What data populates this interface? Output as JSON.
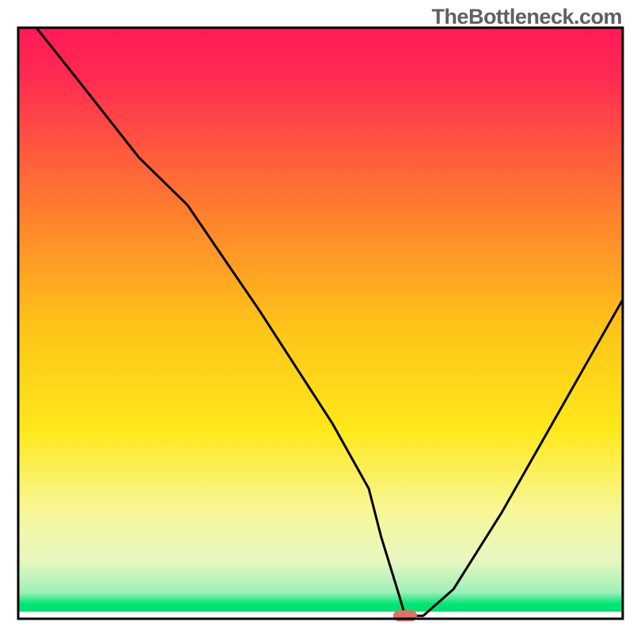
{
  "watermark": "TheBottleneck.com",
  "chart_data": {
    "type": "line",
    "title": "",
    "xlabel": "",
    "ylabel": "",
    "xlim": [
      0,
      100
    ],
    "ylim": [
      0,
      100
    ],
    "axes_visible": false,
    "background_gradient": {
      "top": "#ff1a56",
      "upper_mid": "#ff8a2a",
      "mid": "#ffe81a",
      "lower_mid": "#f7f79a",
      "green": "#00e676",
      "bottom_band": "#ffffff"
    },
    "series": [
      {
        "name": "bottleneck-curve",
        "x": [
          3,
          10,
          20,
          28,
          40,
          52,
          58,
          60,
          63,
          64,
          67,
          72,
          80,
          90,
          100
        ],
        "y": [
          100,
          91,
          78,
          70,
          52,
          33,
          22,
          14,
          4,
          0.5,
          0.5,
          5,
          18,
          36,
          54
        ]
      }
    ],
    "marker": {
      "x": 64,
      "y": 0.5,
      "color": "#d9746a",
      "label": "optimal-point"
    },
    "frame": {
      "inset_top": 35,
      "inset_left": 23,
      "inset_right": 13,
      "inset_bottom": 18,
      "stroke": "#000000",
      "stroke_width": 3
    }
  }
}
